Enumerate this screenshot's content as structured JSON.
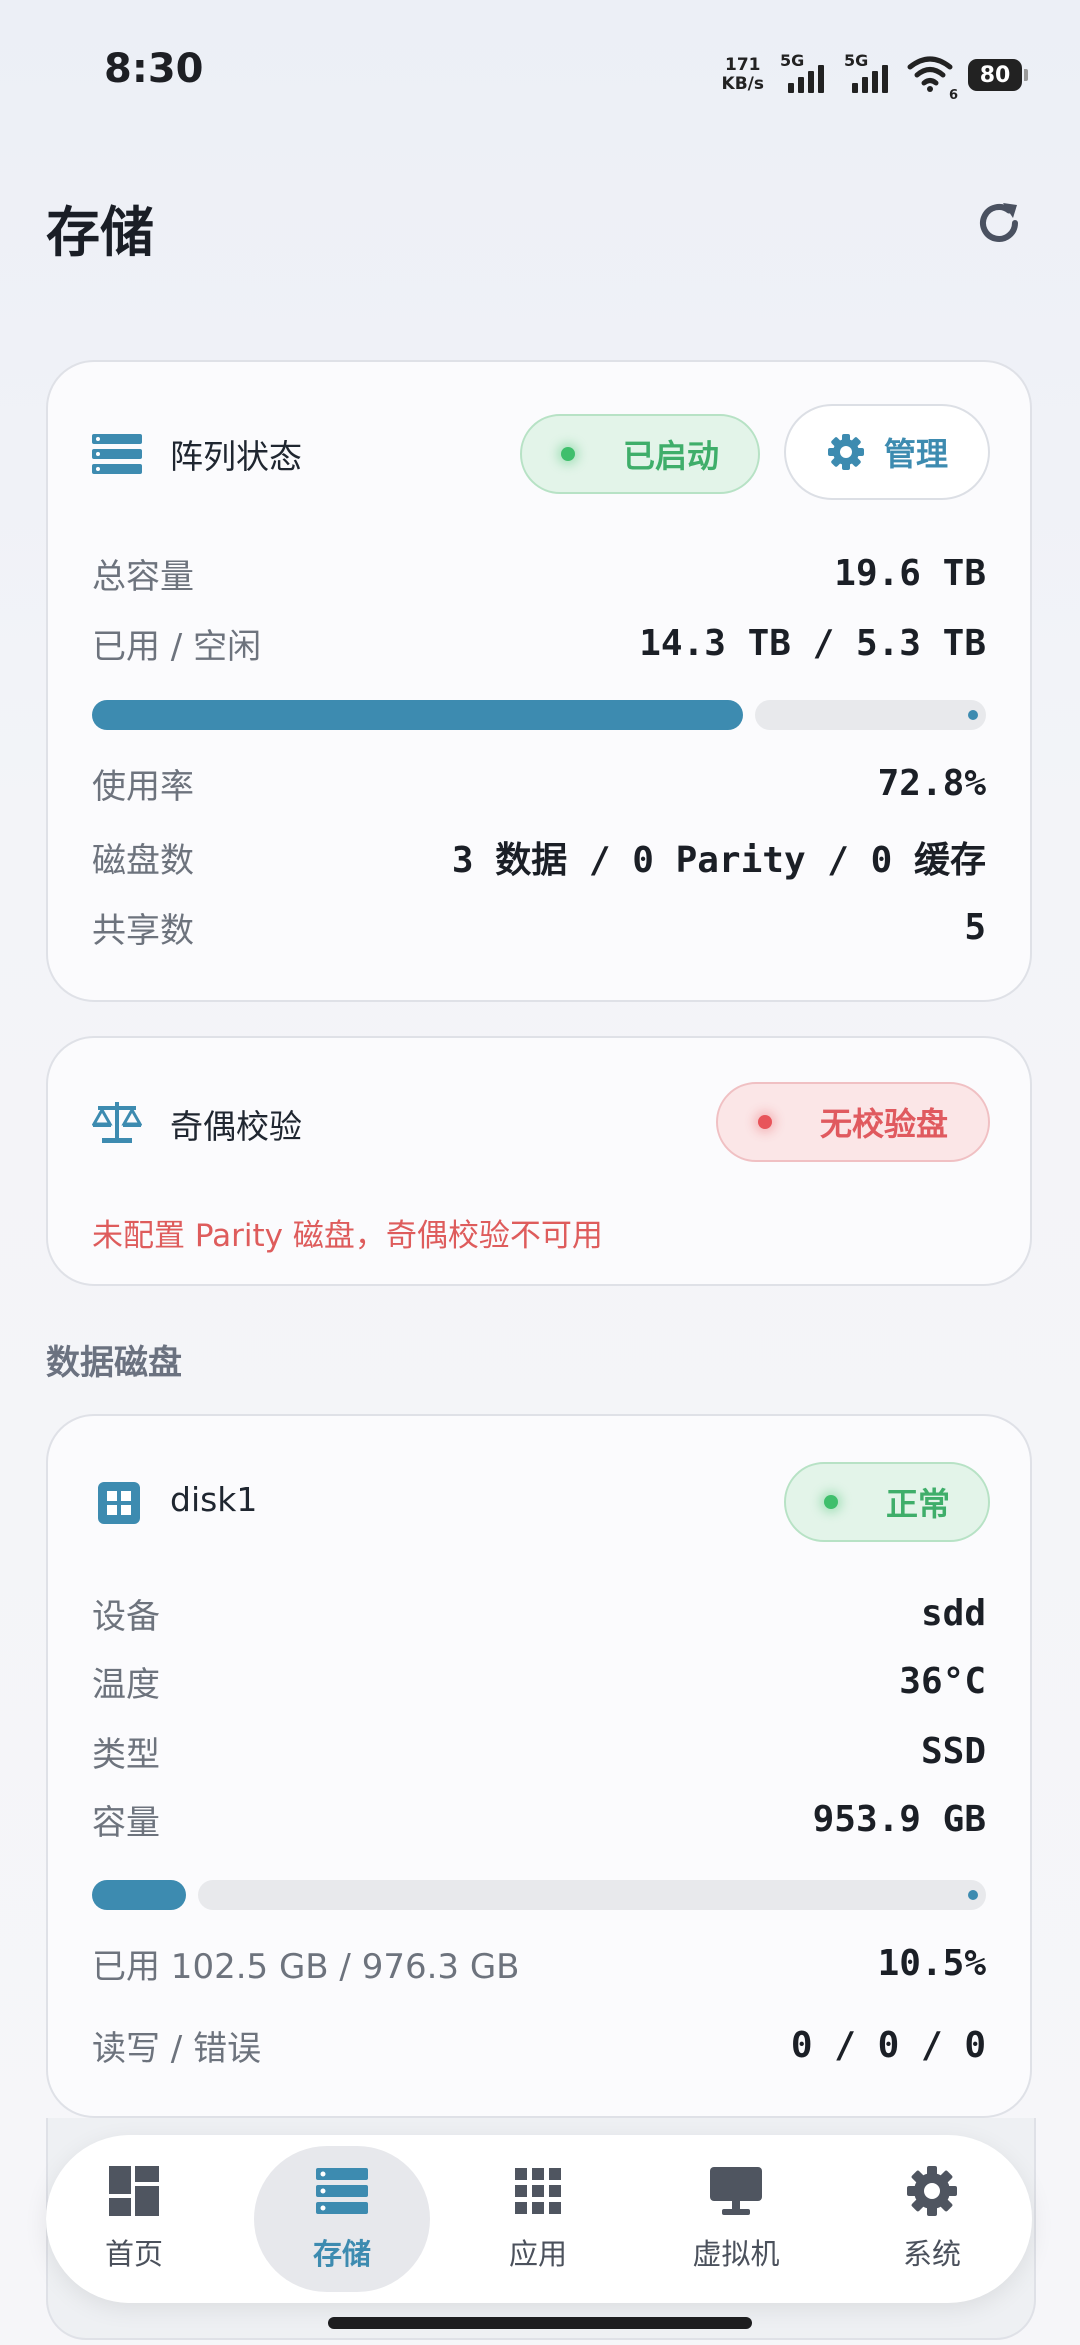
{
  "status_bar": {
    "time": "8:30",
    "net_speed_value": "171",
    "net_speed_unit": "KB/s",
    "signal1_label": "5G",
    "signal2_label": "5G",
    "wifi_badge": "6",
    "battery": "80"
  },
  "header": {
    "title": "存储"
  },
  "array_card": {
    "title": "阵列状态",
    "status_label": "已启动",
    "manage_label": "管理",
    "rows": [
      {
        "key": "总容量",
        "value": "19.6 TB"
      },
      {
        "key": "已用 / 空闲",
        "value": "14.3 TB / 5.3 TB"
      }
    ],
    "usage_fraction": 0.728,
    "rows2": [
      {
        "key": "使用率",
        "value": "72.8%"
      },
      {
        "key": "磁盘数",
        "value": "3 数据 / 0 Parity / 0 缓存"
      },
      {
        "key": "共享数",
        "value": "5"
      }
    ]
  },
  "parity_card": {
    "title": "奇偶校验",
    "status_label": "无校验盘",
    "message": "未配置 Parity 磁盘，奇偶校验不可用"
  },
  "section": {
    "data_disks_label": "数据磁盘"
  },
  "disk_card": {
    "title": "disk1",
    "status_label": "正常",
    "rows": [
      {
        "key": "设备",
        "value": "sdd"
      },
      {
        "key": "温度",
        "value": "36°C"
      },
      {
        "key": "类型",
        "value": "SSD"
      },
      {
        "key": "容量",
        "value": "953.9 GB"
      }
    ],
    "usage_fraction": 0.105,
    "usage_text": "已用 102.5 GB / 976.3 GB",
    "usage_percent": "10.5%",
    "io_key": "读写 / 错误",
    "io_value": "0 / 0 / 0"
  },
  "nav": {
    "items": [
      {
        "label": "首页",
        "icon": "dashboard-icon"
      },
      {
        "label": "存储",
        "icon": "storage-icon"
      },
      {
        "label": "应用",
        "icon": "apps-grid-icon"
      },
      {
        "label": "虚拟机",
        "icon": "monitor-icon"
      },
      {
        "label": "系统",
        "icon": "gear-icon"
      }
    ],
    "active_index": 1
  },
  "colors": {
    "accent": "#3d8bb0",
    "green": "#3fae6a",
    "red": "#e05a5f"
  }
}
